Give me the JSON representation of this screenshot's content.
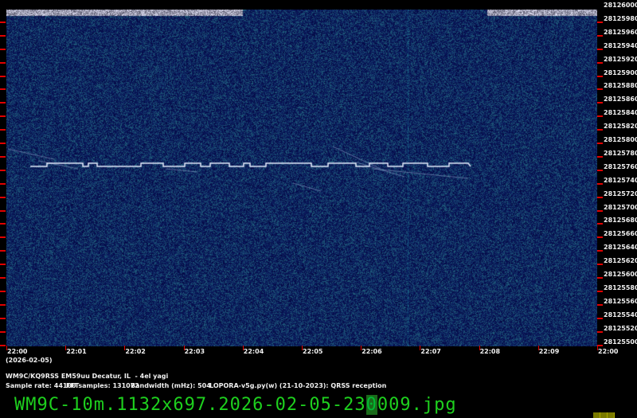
{
  "spectrogram": {
    "y_axis_labels": [
      "28126000",
      "28125980",
      "28125960",
      "28125940",
      "28125920",
      "28125900",
      "28125880",
      "28125860",
      "28125840",
      "28125820",
      "28125800",
      "28125780",
      "28125760",
      "28125740",
      "28125720",
      "28125700",
      "28125680",
      "28125660",
      "28125640",
      "28125620",
      "28125600",
      "28125580",
      "28125560",
      "28125540",
      "28125520",
      "28125500"
    ],
    "x_axis_labels": [
      "22:00",
      "22:01",
      "22:02",
      "22:03",
      "22:04",
      "22:05",
      "22:06",
      "22:07",
      "22:08",
      "22:09",
      "22:00"
    ],
    "date_label": "(2026-02-05)",
    "colors": {
      "background": "#0a1a5a",
      "signal": "#e8f0ff",
      "tick": "#e00000"
    }
  },
  "info": {
    "station": "WM9C/KQ9RSS EM59uu Decatur, IL  - 4el yagi",
    "sample_rate": "Sample rate: 44100",
    "fft_samples": "FFTsamples: 131072",
    "bandwidth": "Bandwidth (mHz): 504",
    "software": "LOPORA-v5g.py(w) (21-10-2023): QRSS reception"
  },
  "filename": {
    "prefix": "WM9C-10m.1132x697.2026-02-05-23",
    "cursor": "0",
    "suffix": "009.jpg"
  }
}
